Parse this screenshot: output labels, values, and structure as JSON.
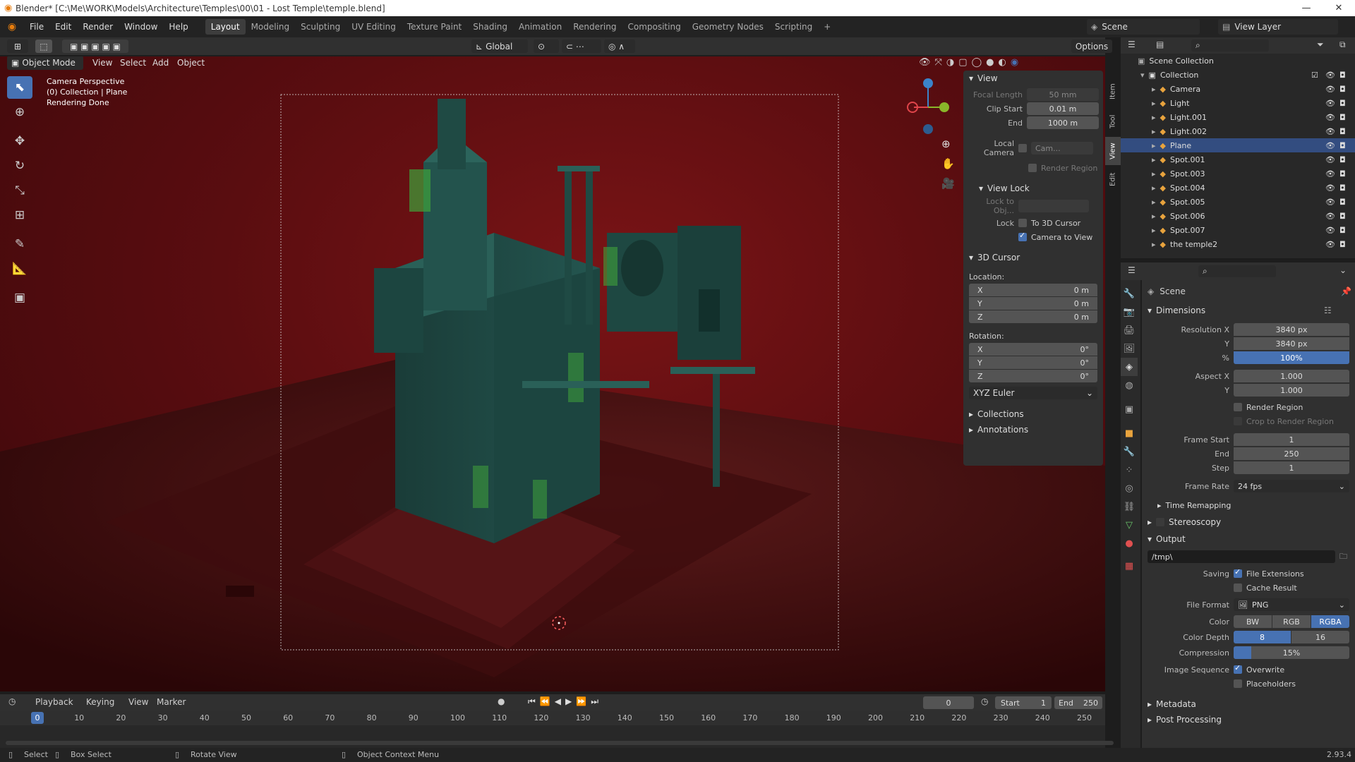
{
  "window": {
    "title": "Blender* [C:\\Me\\WORK\\Models\\Architecture\\Temples\\00\\01 - Lost Temple\\temple.blend]"
  },
  "menu": {
    "items": [
      "File",
      "Edit",
      "Render",
      "Window",
      "Help"
    ]
  },
  "workspaces": [
    "Layout",
    "Modeling",
    "Sculpting",
    "UV Editing",
    "Texture Paint",
    "Shading",
    "Animation",
    "Rendering",
    "Compositing",
    "Geometry Nodes",
    "Scripting"
  ],
  "scene_name": "Scene",
  "view_layer": "View Layer",
  "header3d": {
    "mode": "Object Mode",
    "menus": [
      "View",
      "Select",
      "Add",
      "Object"
    ],
    "orientation": "Global",
    "options": "Options"
  },
  "overlay_text": [
    "Camera Perspective",
    "(0) Collection | Plane",
    "Rendering Done"
  ],
  "npanel": {
    "tabs": [
      "Item",
      "Tool",
      "View",
      "Edit"
    ],
    "view_title": "View",
    "focal_length_label": "Focal Length",
    "focal_length": "50 mm",
    "clip_start_label": "Clip Start",
    "clip_start": "0.01 m",
    "clip_end_label": "End",
    "clip_end": "1000 m",
    "local_camera_label": "Local Camera",
    "local_camera_value": "Cam...",
    "render_region": "Render Region",
    "view_lock_title": "View Lock",
    "lock_to_obj": "Lock to Obj...",
    "lock_label": "Lock",
    "to_3d_cursor": "To 3D Cursor",
    "camera_to_view": "Camera to View",
    "cursor_title": "3D Cursor",
    "location_label": "Location:",
    "loc": [
      {
        "axis": "X",
        "value": "0 m"
      },
      {
        "axis": "Y",
        "value": "0 m"
      },
      {
        "axis": "Z",
        "value": "0 m"
      }
    ],
    "rotation_label": "Rotation:",
    "rot": [
      {
        "axis": "X",
        "value": "0°"
      },
      {
        "axis": "Y",
        "value": "0°"
      },
      {
        "axis": "Z",
        "value": "0°"
      }
    ],
    "rot_mode": "XYZ Euler",
    "collections": "Collections",
    "annotations": "Annotations"
  },
  "outliner": {
    "root": "Scene Collection",
    "collection": "Collection",
    "items": [
      "Camera",
      "Light",
      "Light.001",
      "Light.002",
      "Plane",
      "Spot.001",
      "Spot.003",
      "Spot.004",
      "Spot.005",
      "Spot.006",
      "Spot.007",
      "the temple2"
    ],
    "selected": "Plane"
  },
  "props": {
    "context": "Scene",
    "dimensions": "Dimensions",
    "res_x_label": "Resolution X",
    "res_x": "3840 px",
    "res_y_label": "Y",
    "res_y": "3840 px",
    "res_pct_label": "%",
    "res_pct": "100%",
    "aspect_x_label": "Aspect X",
    "aspect_x": "1.000",
    "aspect_y_label": "Y",
    "aspect_y": "1.000",
    "render_region": "Render Region",
    "crop": "Crop to Render Region",
    "frame_start_label": "Frame Start",
    "frame_start": "1",
    "frame_end_label": "End",
    "frame_end": "250",
    "frame_step_label": "Step",
    "frame_step": "1",
    "frame_rate_label": "Frame Rate",
    "frame_rate": "24 fps",
    "time_remapping": "Time Remapping",
    "stereoscopy": "Stereoscopy",
    "output": "Output",
    "path": "/tmp\\",
    "saving_label": "Saving",
    "file_ext": "File Extensions",
    "cache_result": "Cache Result",
    "file_format_label": "File Format",
    "file_format": "PNG",
    "color_label": "Color",
    "color_opts": [
      "BW",
      "RGB",
      "RGBA"
    ],
    "depth_label": "Color Depth",
    "depth_opts": [
      "8",
      "16"
    ],
    "compression_label": "Compression",
    "compression": "15%",
    "compression_fraction": 0.15,
    "seq_label": "Image Sequence",
    "overwrite": "Overwrite",
    "placeholders": "Placeholders",
    "metadata": "Metadata",
    "post_processing": "Post Processing"
  },
  "timeline": {
    "menus": [
      "Playback",
      "Keying",
      "View",
      "Marker"
    ],
    "current_frame": "0",
    "start_label": "Start",
    "start": "1",
    "end_label": "End",
    "end": "250",
    "ticks": [
      "0",
      "10",
      "20",
      "30",
      "40",
      "50",
      "60",
      "70",
      "80",
      "90",
      "100",
      "110",
      "120",
      "130",
      "140",
      "150",
      "160",
      "170",
      "180",
      "190",
      "200",
      "210",
      "220",
      "230",
      "240",
      "250"
    ]
  },
  "status": {
    "select": "Select",
    "box_select": "Box Select",
    "rotate_view": "Rotate View",
    "context_menu": "Object Context Menu",
    "version": "2.93.4"
  },
  "colors": {
    "accent": "#4772b3",
    "selection": "#334d80",
    "viewport_bg": "#6e1214",
    "temple": "#1f4a44"
  }
}
